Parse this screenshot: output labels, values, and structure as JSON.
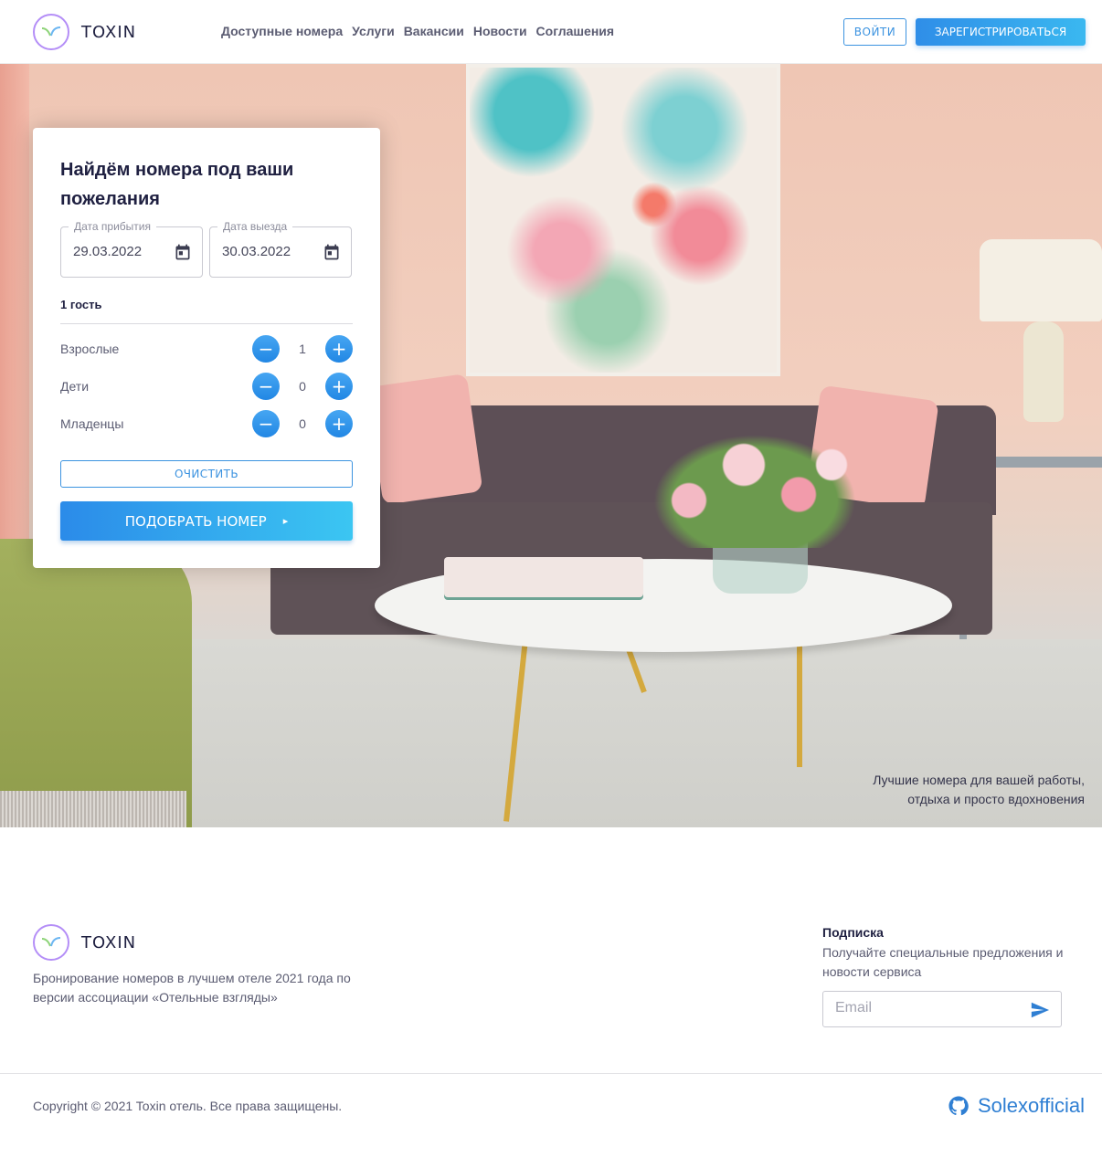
{
  "header": {
    "logo_text": "TOXIN",
    "nav": [
      "Доступные номера",
      "Услуги",
      "Вакансии",
      "Новости",
      "Соглашения"
    ],
    "login_label": "ВОЙТИ",
    "register_label": "ЗАРЕГИСТРИРОВАТЬСЯ"
  },
  "hero": {
    "caption_line1": "Лучшие номера для вашей работы,",
    "caption_line2": "отдыха и просто вдохновения"
  },
  "search_card": {
    "title": "Найдём номера под ваши пожелания",
    "arrival": {
      "label": "Дата прибытия",
      "value": "29.03.2022",
      "icon": "calendar-icon"
    },
    "departure": {
      "label": "Дата выезда",
      "value": "30.03.2022",
      "icon": "calendar-icon"
    },
    "guests_summary": "1 гость",
    "guests": [
      {
        "label": "Взрослые",
        "count": "1"
      },
      {
        "label": "Дети",
        "count": "0"
      },
      {
        "label": "Младенцы",
        "count": "0"
      }
    ],
    "minus_symbol": "−",
    "plus_symbol": "+",
    "clear_label": "ОЧИСТИТЬ",
    "find_label": "ПОДОБРАТЬ НОМЕР",
    "find_arrow": "▸"
  },
  "footer": {
    "logo_text": "TOXIN",
    "description": "Бронирование номеров в лучшем отеле 2021 года по версии ассоциации «Отельные взгляды»",
    "subscribe_title": "Подписка",
    "subscribe_text": "Получайте специальные предложения и новости сервиса",
    "email_placeholder": "Email",
    "copyright": "Copyright © 2021 Toxin отель. Все права защищены.",
    "github_label": "Solexofficial"
  },
  "colors": {
    "accent": "#2f8ee8",
    "accent_light": "#3bc6f2",
    "logo_ring": "#b48ef7",
    "text_dark": "#1f2041",
    "text_muted": "#5b5c72"
  }
}
